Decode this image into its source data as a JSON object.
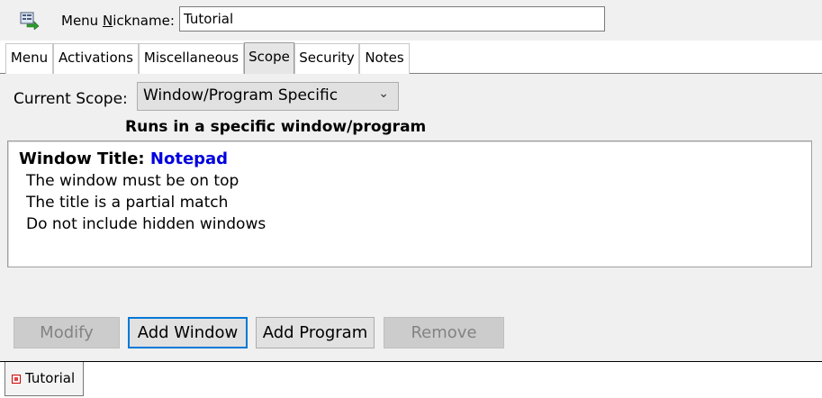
{
  "header": {
    "nickname_label_prefix": "Menu ",
    "nickname_label_accel": "N",
    "nickname_label_suffix": "ickname:",
    "nickname_value": "Tutorial"
  },
  "tabs": [
    {
      "label": "Menu",
      "active": false
    },
    {
      "label": "Activations",
      "active": false
    },
    {
      "label": "Miscellaneous",
      "active": false
    },
    {
      "label": "Scope",
      "active": true
    },
    {
      "label": "Security",
      "active": false
    },
    {
      "label": "Notes",
      "active": false
    }
  ],
  "scope": {
    "label": "Current Scope:",
    "selected": "Window/Program Specific",
    "description": "Runs in a specific window/program"
  },
  "info": {
    "title_label": "Window Title:",
    "title_value": "Notepad",
    "lines": [
      "The window must be on top",
      "The title is a partial match",
      "Do not include hidden windows"
    ]
  },
  "buttons": {
    "modify": "Modify",
    "add_window": "Add Window",
    "add_program": "Add Program",
    "remove": "Remove"
  },
  "document_tab": {
    "label": "Tutorial"
  },
  "colors": {
    "accent": "#0078d7",
    "title_value": "#0000e0"
  }
}
